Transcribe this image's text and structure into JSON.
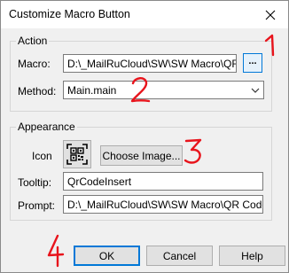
{
  "window": {
    "title": "Customize Macro Button"
  },
  "action": {
    "legend": "Action",
    "macro_label": "Macro:",
    "macro_value": "D:\\_MailRuCloud\\SW\\SW Macro\\QR",
    "browse_label": "...",
    "method_label": "Method:",
    "method_value": "Main.main"
  },
  "appearance": {
    "legend": "Appearance",
    "icon_label": "Icon",
    "choose_image_label": "Choose Image...",
    "tooltip_label": "Tooltip:",
    "tooltip_value": "QrCodeInsert",
    "prompt_label": "Prompt:",
    "prompt_value": "D:\\_MailRuCloud\\SW\\SW Macro\\QR Code"
  },
  "buttons": {
    "ok": "OK",
    "cancel": "Cancel",
    "help": "Help"
  },
  "annotations": [
    "1",
    "2",
    "3",
    "4"
  ],
  "colors": {
    "annotation": "#e8141c",
    "focus": "#0078d7"
  }
}
